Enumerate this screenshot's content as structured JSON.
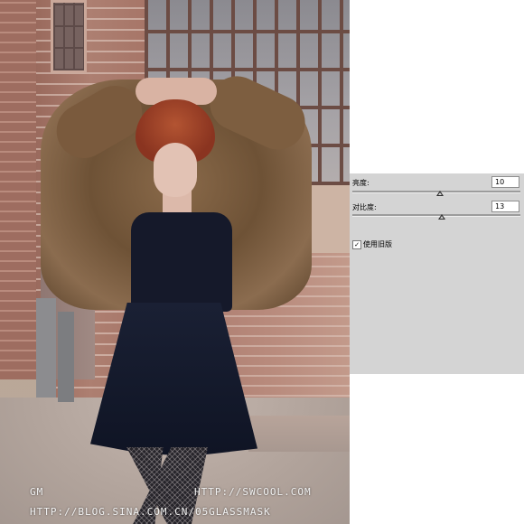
{
  "photo": {
    "watermark_left": "GM",
    "watermark_site": "HTTP://SWCOOL.COM",
    "watermark_blog": "HTTP://BLOG.SINA.COM.CN/05GLASSMASK"
  },
  "adjustments": {
    "brightness": {
      "label": "亮度:",
      "value": "10",
      "slider_fraction": 0.52
    },
    "contrast": {
      "label": "对比度:",
      "value": "13",
      "slider_fraction": 0.53
    },
    "legacy": {
      "label": "使用旧版",
      "checked": true,
      "check_glyph": "✓"
    }
  }
}
